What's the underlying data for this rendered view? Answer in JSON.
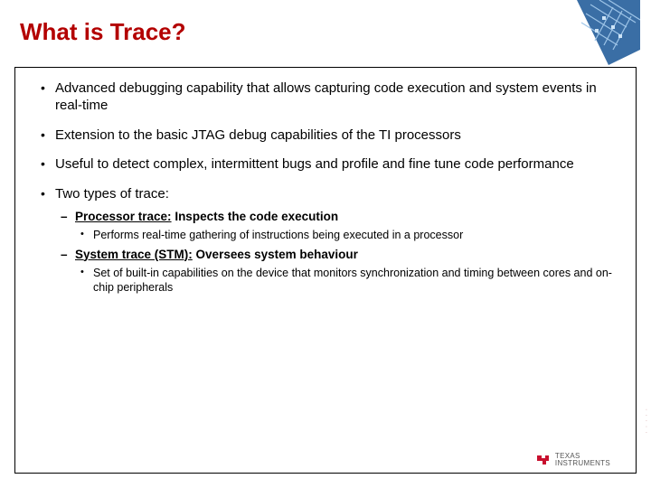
{
  "title": "What is Trace?",
  "bullets": [
    {
      "text": "Advanced debugging capability that allows capturing code execution and system events in real-time"
    },
    {
      "text": "Extension to the basic JTAG debug capabilities of the TI processors"
    },
    {
      "text": "Useful to detect complex, intermittent bugs and profile and fine tune code performance"
    },
    {
      "text": "Two types of trace:"
    }
  ],
  "sub": {
    "proc_label": "Processor trace:",
    "proc_rest": " Inspects the code execution",
    "proc_detail": "Performs real-time gathering of instructions being executed in a processor",
    "sys_label": "System trace (STM):",
    "sys_rest": "  Oversees system behaviour",
    "sys_detail": "Set of built-in capabilities on the device that monitors synchronization and timing between cores and on-chip peripherals"
  },
  "logo": {
    "line1": "Texas",
    "line2": "Instruments"
  }
}
